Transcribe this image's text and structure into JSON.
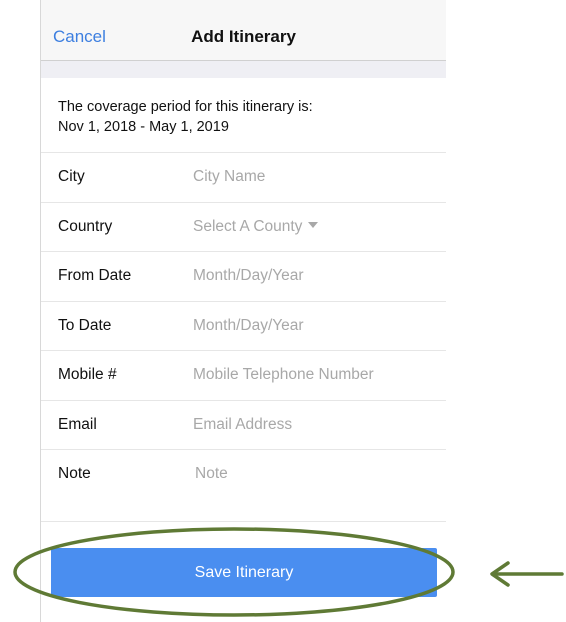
{
  "nav": {
    "cancel_label": "Cancel",
    "title": "Add Itinerary"
  },
  "coverage": {
    "line1": "The coverage period for this itinerary is:",
    "line2": "Nov 1, 2018 - May 1, 2019"
  },
  "form": {
    "city": {
      "label": "City",
      "placeholder": "City Name"
    },
    "country": {
      "label": "Country",
      "placeholder": "Select A County"
    },
    "from_date": {
      "label": "From Date",
      "placeholder": "Month/Day/Year"
    },
    "to_date": {
      "label": "To Date",
      "placeholder": "Month/Day/Year"
    },
    "mobile": {
      "label": "Mobile #",
      "placeholder": "Mobile Telephone Number"
    },
    "email": {
      "label": "Email",
      "placeholder": "Email Address"
    },
    "note": {
      "label": "Note",
      "placeholder": "Note"
    }
  },
  "save_button": {
    "label": "Save Itinerary"
  },
  "colors": {
    "accent": "#4a8ef0",
    "link": "#3d7fe0",
    "annotation": "#5f7a35"
  },
  "icons": {
    "country_dropdown": "caret-down-icon",
    "annotation_arrow": "arrow-left-icon"
  }
}
